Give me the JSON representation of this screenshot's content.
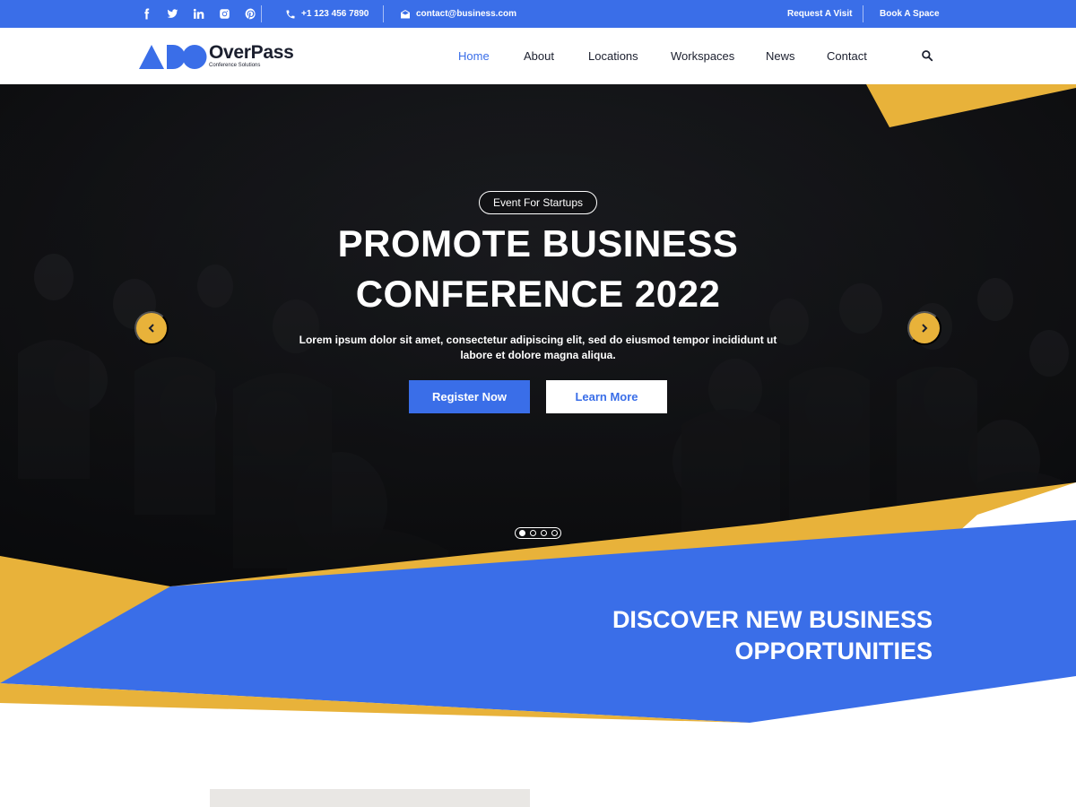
{
  "topbar": {
    "social_icons": [
      "facebook-icon",
      "twitter-icon",
      "linkedin-icon",
      "instagram-icon",
      "pinterest-icon"
    ],
    "phone": "+1 123 456 7890",
    "email": "contact@business.com",
    "request_visit": "Request A Visit",
    "book_space": "Book A Space"
  },
  "nav": {
    "brand": "OverPass",
    "tagline": "Conference Solutions",
    "items": [
      "Home",
      "About",
      "Locations",
      "Workspaces",
      "News",
      "Contact"
    ],
    "active": "Home"
  },
  "hero": {
    "badge": "Event For Startups",
    "title_line1": "PROMOTE BUSINESS",
    "title_line2": "CONFERENCE 2022",
    "text_line1": "Lorem ipsum dolor sit amet, consectetur adipiscing elit, sed do eiusmod tempor incididunt ut",
    "text_line2": "labore et dolore magna aliqua.",
    "primary_button": "Register Now",
    "secondary_button": "Learn More",
    "slides_total": 4,
    "active_slide": 1
  },
  "discover": {
    "line1": "DISCOVER NEW BUSINESS",
    "line2": "OPPORTUNITIES"
  },
  "colors": {
    "primary": "#3a6ee8",
    "accent": "#e8b23a",
    "dark": "#1b1f2e"
  }
}
